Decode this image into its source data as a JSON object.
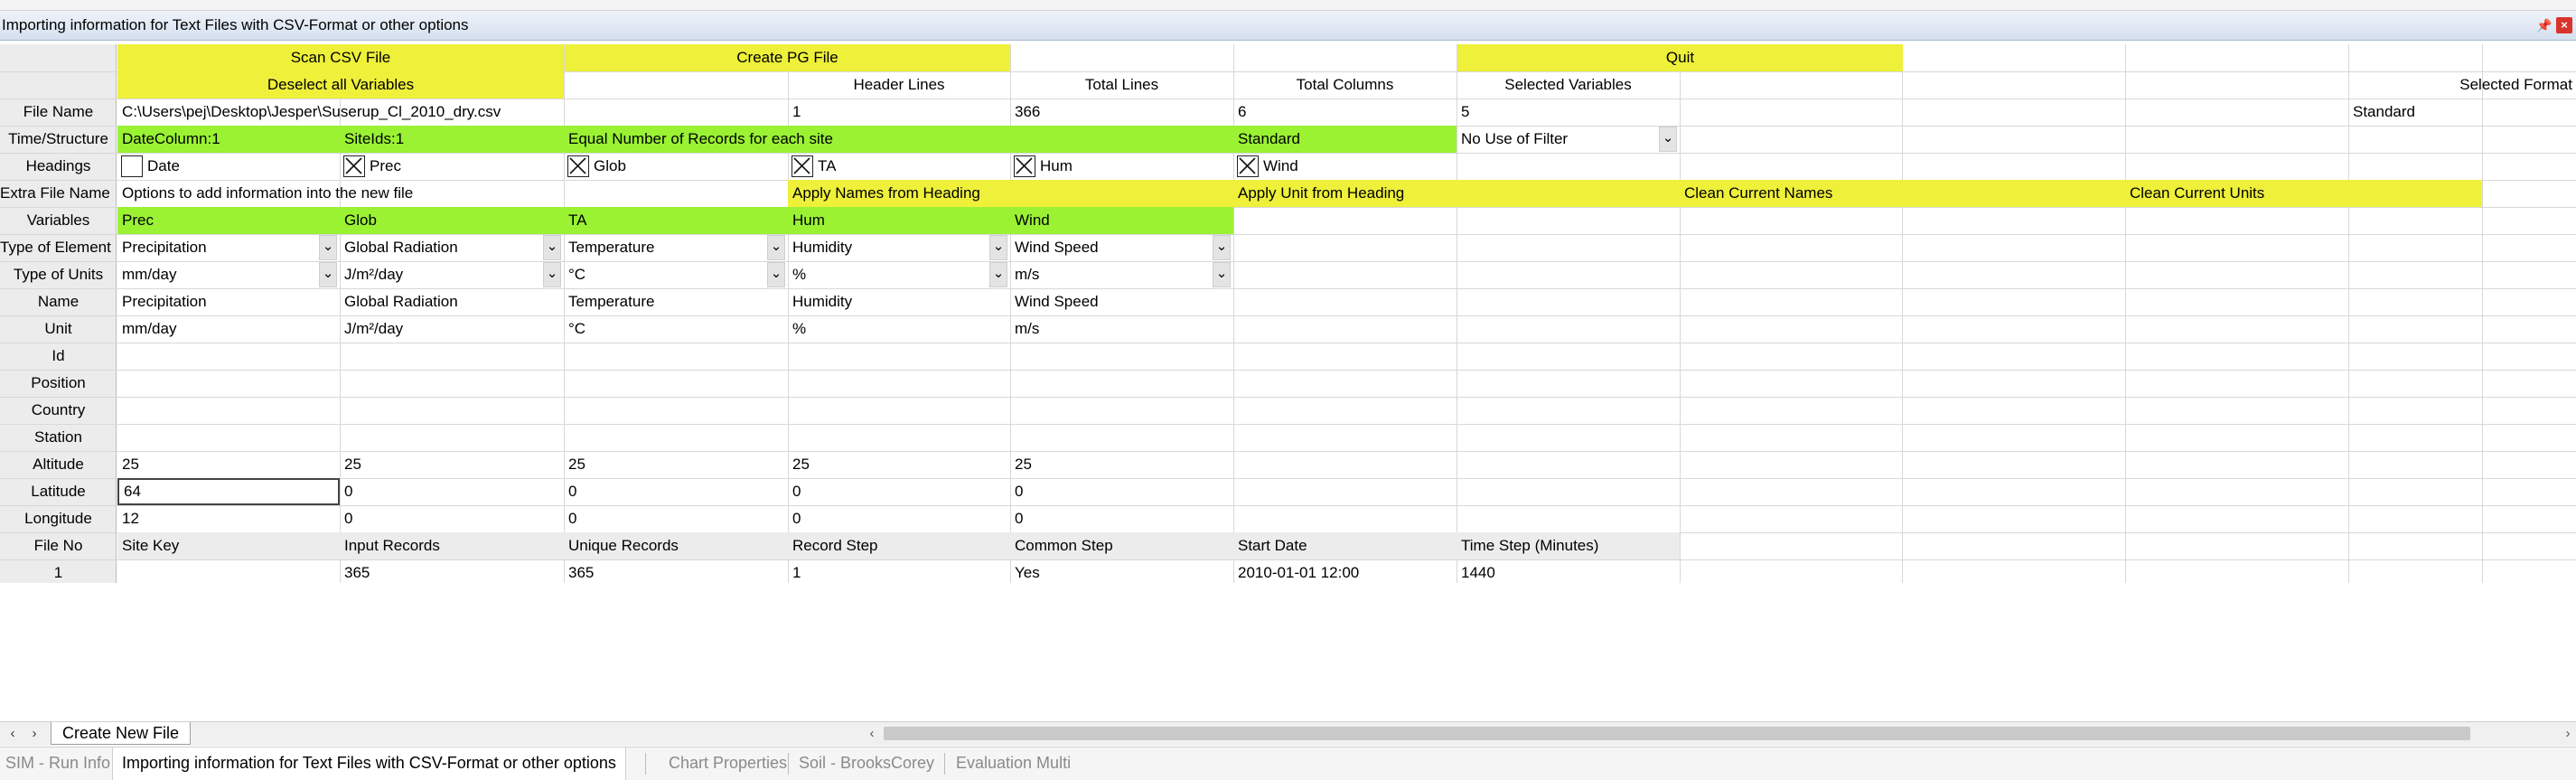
{
  "window": {
    "title": "Importing information for Text Files with CSV-Format or other options"
  },
  "row_labels": {
    "file_name": "File Name",
    "time_structure": "Time/Structure",
    "headings": "Headings",
    "extra_file_name": "Extra File Name",
    "variables": "Variables",
    "type_of_element": "Type of Element",
    "type_of_units": "Type of Units",
    "name": "Name",
    "unit": "Unit",
    "id": "Id",
    "position": "Position",
    "country": "Country",
    "station": "Station",
    "altitude": "Altitude",
    "latitude": "Latitude",
    "longitude": "Longitude",
    "file_no": "File No",
    "row_1": "1"
  },
  "buttons": {
    "scan_csv": "Scan CSV File",
    "create_pg": "Create PG File",
    "quit": "Quit",
    "deselect_all": "Deselect all Variables",
    "apply_names": "Apply Names from Heading",
    "apply_unit": "Apply Unit from Heading",
    "clean_names": "Clean Current Names",
    "clean_units": "Clean Current Units"
  },
  "header_labels": {
    "header_lines": "Header Lines",
    "total_lines": "Total Lines",
    "total_columns": "Total Columns",
    "selected_variables": "Selected Variables",
    "selected_format": "Selected Format"
  },
  "file_info": {
    "path": "C:\\Users\\pej\\Desktop\\Jesper\\Suserup_Cl_2010_dry.csv",
    "header_lines": "1",
    "total_lines": "366",
    "total_columns": "6",
    "selected_variables": "5",
    "selected_format": "Standard"
  },
  "time_structure": {
    "date_column": "DateColumn:1",
    "site_ids": "SiteIds:1",
    "equal_records": "Equal Number of Records for each site",
    "standard": "Standard",
    "filter": "No Use of Filter"
  },
  "headings": [
    {
      "label": "Date",
      "checked": false
    },
    {
      "label": "Prec",
      "checked": true
    },
    {
      "label": "Glob",
      "checked": true
    },
    {
      "label": "TA",
      "checked": true
    },
    {
      "label": "Hum",
      "checked": true
    },
    {
      "label": "Wind",
      "checked": true
    }
  ],
  "extra_file_name": {
    "info": "Options to add information into the new file"
  },
  "variables": [
    {
      "code": "Prec",
      "element": "Precipitation",
      "units": "mm/day",
      "name": "Precipitation",
      "unit": "mm/day",
      "altitude": "25",
      "latitude": "64",
      "longitude": "12"
    },
    {
      "code": "Glob",
      "element": "Global Radiation",
      "units": "J/m²/day",
      "name": "Global Radiation",
      "unit": "J/m²/day",
      "altitude": "25",
      "latitude": "0",
      "longitude": "0"
    },
    {
      "code": "TA",
      "element": "Temperature",
      "units": "°C",
      "name": "Temperature",
      "unit": "°C",
      "altitude": "25",
      "latitude": "0",
      "longitude": "0"
    },
    {
      "code": "Hum",
      "element": "Humidity",
      "units": "%",
      "name": "Humidity",
      "unit": "%",
      "altitude": "25",
      "latitude": "0",
      "longitude": "0"
    },
    {
      "code": "Wind",
      "element": "Wind Speed",
      "units": "m/s",
      "name": "Wind Speed",
      "unit": "m/s",
      "altitude": "25",
      "latitude": "0",
      "longitude": "0"
    }
  ],
  "file_table": {
    "headers": [
      "Site Key",
      "Input Records",
      "Unique Records",
      "Record Step",
      "Common Step",
      "Start Date",
      "Time Step (Minutes)"
    ],
    "rows": [
      [
        "",
        "365",
        "365",
        "1",
        "Yes",
        "2010-01-01 12:00",
        "1440"
      ]
    ]
  },
  "sheet_tabs": {
    "active": "Create New File"
  },
  "status_tabs": [
    {
      "label": "SIM - Run Info",
      "active": false
    },
    {
      "label": "Importing information for Text Files with CSV-Format or other options",
      "active": true
    },
    {
      "label": "Chart Properties",
      "active": false
    },
    {
      "label": "Soil - BrooksCorey",
      "active": false
    },
    {
      "label": "Evaluation Multi",
      "active": false
    }
  ],
  "colors": {
    "button_yellow": "#eef03a",
    "header_green": "#9af233",
    "titlebar": "#d5e0ee"
  }
}
